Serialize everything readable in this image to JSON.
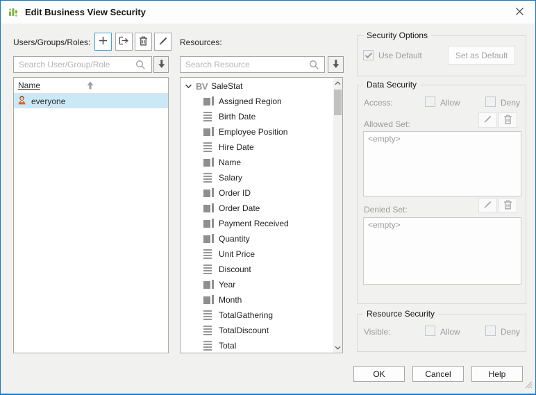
{
  "window": {
    "title": "Edit Business View Security"
  },
  "users_panel": {
    "label": "Users/Groups/Roles:",
    "search_placeholder": "Search User/Group/Role",
    "table": {
      "header": "Name",
      "rows": [
        {
          "name": "everyone"
        }
      ]
    }
  },
  "resources_panel": {
    "label": "Resources:",
    "search_placeholder": "Search Resource",
    "tree": {
      "root": {
        "badge": "BV",
        "label": "SaleStat",
        "expanded": true
      },
      "items": [
        {
          "label": "Assigned Region",
          "icon": "dimension"
        },
        {
          "label": "Birth Date",
          "icon": "measure"
        },
        {
          "label": "Employee Position",
          "icon": "dimension"
        },
        {
          "label": "Hire Date",
          "icon": "measure"
        },
        {
          "label": "Name",
          "icon": "dimension"
        },
        {
          "label": "Salary",
          "icon": "measure"
        },
        {
          "label": "Order ID",
          "icon": "dimension"
        },
        {
          "label": "Order Date",
          "icon": "dimension"
        },
        {
          "label": "Payment Received",
          "icon": "dimension"
        },
        {
          "label": "Quantity",
          "icon": "dimension"
        },
        {
          "label": "Unit Price",
          "icon": "measure"
        },
        {
          "label": "Discount",
          "icon": "measure"
        },
        {
          "label": "Year",
          "icon": "dimension"
        },
        {
          "label": "Month",
          "icon": "dimension"
        },
        {
          "label": "TotalGathering",
          "icon": "measure"
        },
        {
          "label": "TotalDiscount",
          "icon": "measure"
        },
        {
          "label": "Total",
          "icon": "measure"
        }
      ]
    }
  },
  "security_options": {
    "title": "Security Options",
    "use_default_label": "Use Default",
    "use_default_checked": true,
    "set_as_default_label": "Set as Default"
  },
  "data_security": {
    "title": "Data Security",
    "access_label": "Access:",
    "allow_label": "Allow",
    "deny_label": "Deny",
    "allowed_set_label": "Allowed Set:",
    "allowed_set_value": "<empty>",
    "denied_set_label": "Denied Set:",
    "denied_set_value": "<empty>"
  },
  "resource_security": {
    "title": "Resource Security",
    "visible_label": "Visible:",
    "allow_label": "Allow",
    "deny_label": "Deny"
  },
  "footer": {
    "ok_label": "OK",
    "cancel_label": "Cancel",
    "help_label": "Help"
  },
  "colors": {
    "window_border": "#1079c9",
    "selection_bg": "#cbe8f6",
    "accent_focus": "#41a1dc",
    "icon_green": "#7cb342"
  }
}
